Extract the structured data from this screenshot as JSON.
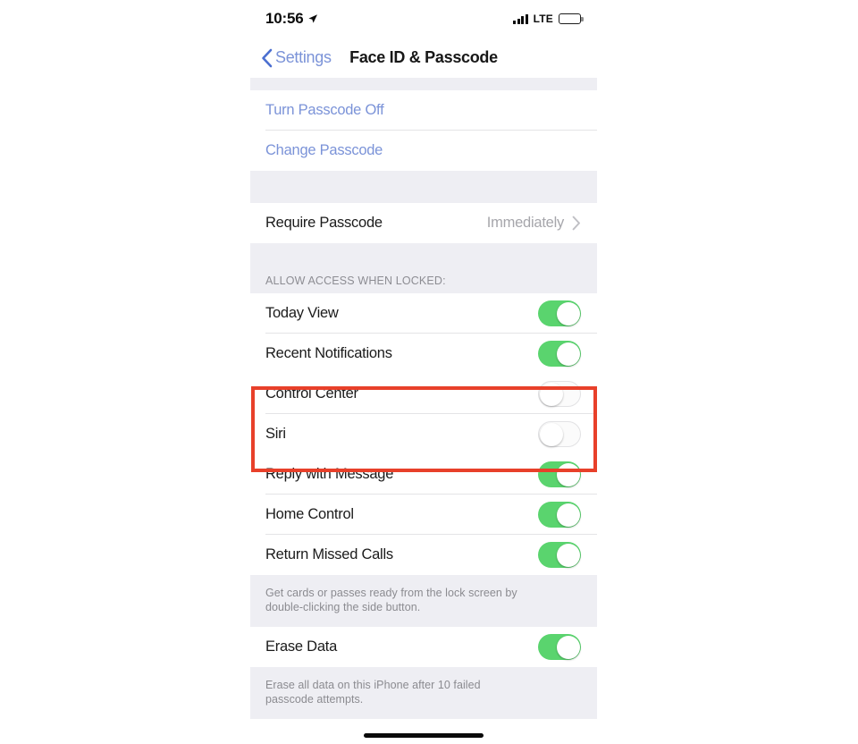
{
  "status_bar": {
    "time": "10:56",
    "location_icon": "location-arrow-icon",
    "signal_icon": "cellular-signal-icon",
    "network": "LTE",
    "battery_icon": "battery-full-icon"
  },
  "nav": {
    "back_icon": "chevron-left-icon",
    "back_label": "Settings",
    "title": "Face ID & Passcode"
  },
  "passcode_group": {
    "turn_off_label": "Turn Passcode Off",
    "change_label": "Change Passcode"
  },
  "require_group": {
    "label": "Require Passcode",
    "value": "Immediately",
    "chevron_icon": "chevron-right-icon"
  },
  "allow_access": {
    "header": "ALLOW ACCESS WHEN LOCKED:",
    "rows": [
      {
        "label": "Today View",
        "state": "on"
      },
      {
        "label": "Recent Notifications",
        "state": "on"
      },
      {
        "label": "Control Center",
        "state": "off"
      },
      {
        "label": "Siri",
        "state": "off"
      },
      {
        "label": "Reply with Message",
        "state": "on"
      },
      {
        "label": "Home Control",
        "state": "on"
      },
      {
        "label": "Return Missed Calls",
        "state": "on"
      }
    ],
    "footer_line1": "Get cards or passes ready from the lock screen by",
    "footer_line2": "double-clicking the side button."
  },
  "erase_group": {
    "label": "Erase Data",
    "state": "on",
    "footer_line1": "Erase all data on this iPhone after 10 failed",
    "footer_line2": "passcode attempts."
  },
  "highlight": {
    "color": "#e8402a",
    "targets": "Control Center, Siri"
  },
  "colors": {
    "toggle_on": "#5ad46e",
    "accent_link": "#7b93d8",
    "group_background": "#eeeef3"
  }
}
